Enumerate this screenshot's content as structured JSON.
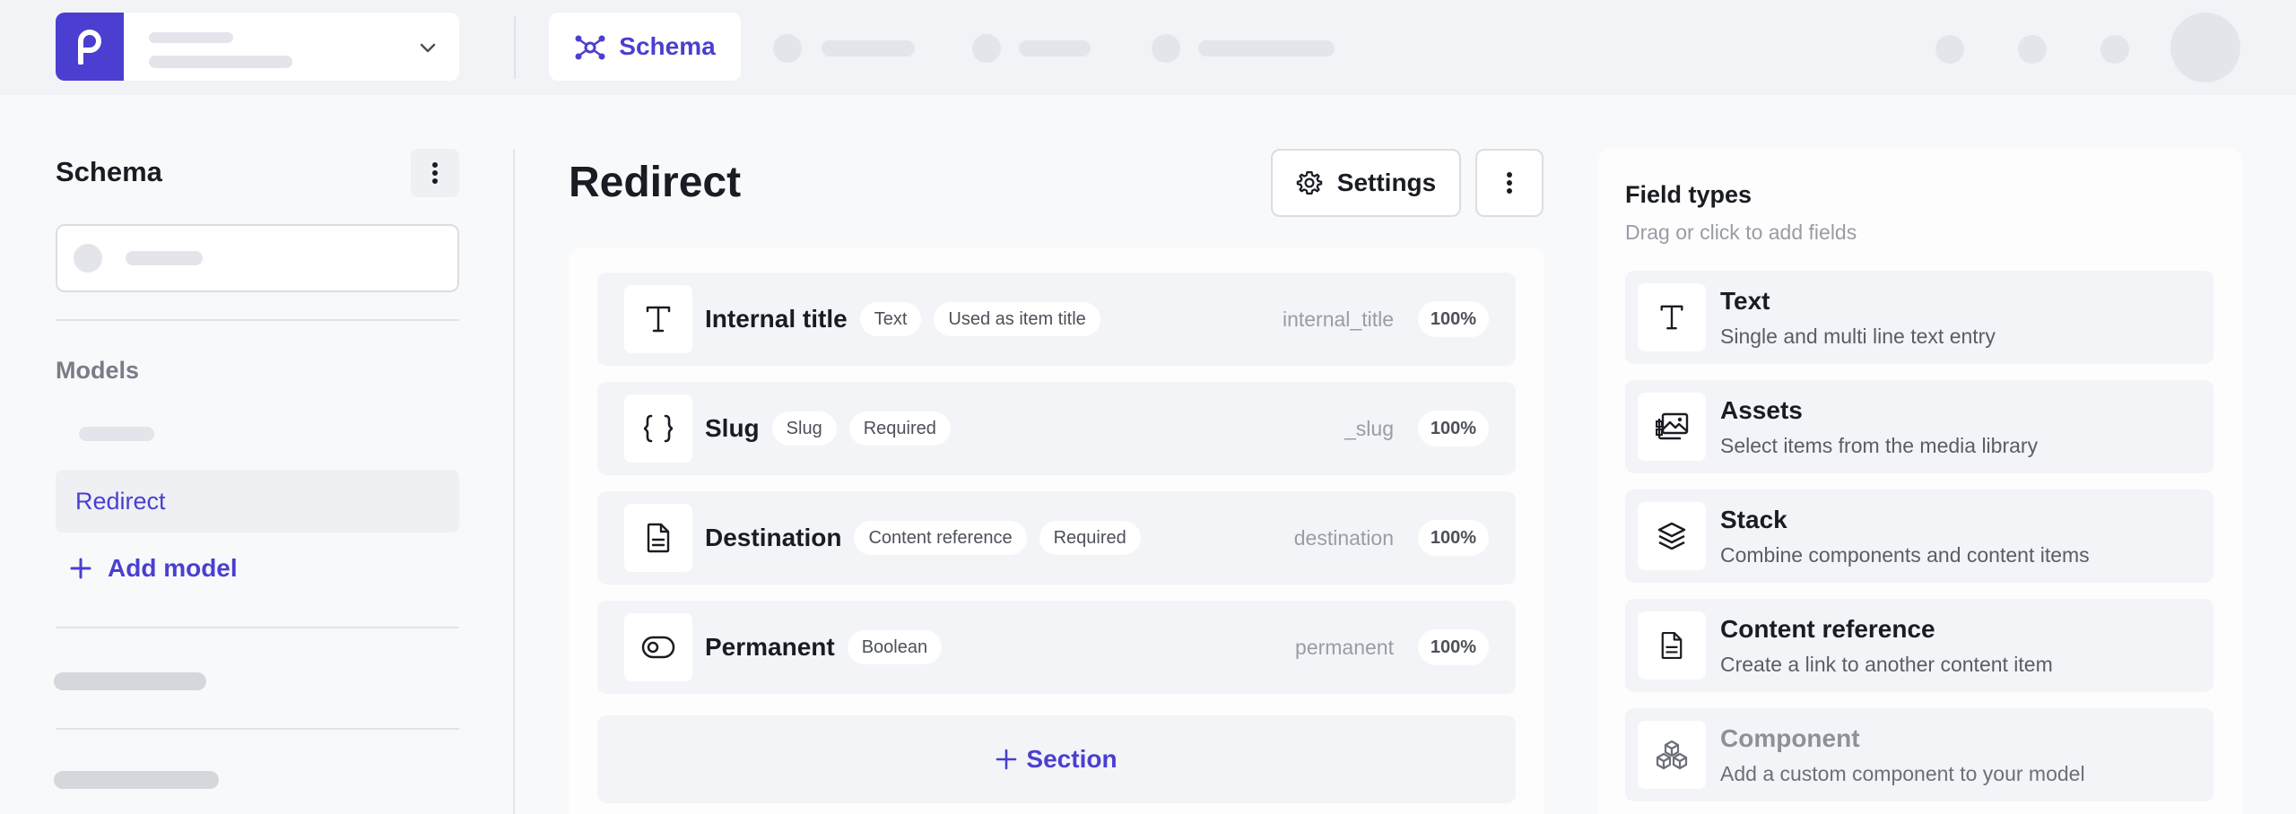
{
  "header": {
    "active_tab": "Schema"
  },
  "sidebar": {
    "title": "Schema",
    "models_label": "Models",
    "active_model": "Redirect",
    "add_model_label": "Add model"
  },
  "main": {
    "title": "Redirect",
    "settings_label": "Settings",
    "fields": [
      {
        "name": "Internal title",
        "tags": [
          "Text",
          "Used as item title"
        ],
        "key": "internal_title",
        "percent": "100%",
        "icon": "text-icon"
      },
      {
        "name": "Slug",
        "tags": [
          "Slug",
          "Required"
        ],
        "key": "_slug",
        "percent": "100%",
        "icon": "braces-icon"
      },
      {
        "name": "Destination",
        "tags": [
          "Content reference",
          "Required"
        ],
        "key": "destination",
        "percent": "100%",
        "icon": "document-icon"
      },
      {
        "name": "Permanent",
        "tags": [
          "Boolean"
        ],
        "key": "permanent",
        "percent": "100%",
        "icon": "toggle-icon"
      }
    ],
    "add_section_label": "Section"
  },
  "field_types": {
    "title": "Field types",
    "subtitle": "Drag or click to add fields",
    "items": [
      {
        "name": "Text",
        "description": "Single and multi line text entry",
        "icon": "text-icon"
      },
      {
        "name": "Assets",
        "description": "Select items from the media library",
        "icon": "images-icon"
      },
      {
        "name": "Stack",
        "description": "Combine components and content items",
        "icon": "layers-icon"
      },
      {
        "name": "Content reference",
        "description": "Create a link to another content item",
        "icon": "document-icon"
      },
      {
        "name": "Component",
        "description": "Add a custom component to your model",
        "icon": "cubes-icon"
      }
    ]
  },
  "colors": {
    "accent": "#4a3fd1",
    "background": "#f8f9fb",
    "topbar": "#f2f3f6"
  }
}
